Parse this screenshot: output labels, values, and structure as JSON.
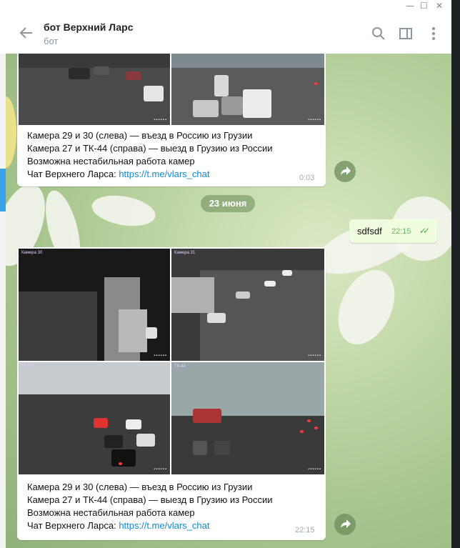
{
  "window": {
    "minimize": "—",
    "maximize": "☐",
    "close": "✕"
  },
  "header": {
    "title": "бот Верхний Ларс",
    "subtitle": "бот"
  },
  "messages": {
    "first": {
      "line1": "Камера 29 и 30 (слева) — въезд в Россию из Грузии",
      "line2": "Камера 27 и ТК-44 (справа) — выезд в Грузию из России",
      "line3": "Возможна нестабильная работа камер",
      "line4_prefix": "Чат Верхнего Ларса: ",
      "link": "https://t.me/vlars_chat",
      "time": "0:03"
    },
    "date_separator": "23 июня",
    "outgoing": {
      "text": "sdfsdf",
      "time": "22:15",
      "status": "✓✓"
    },
    "second": {
      "cam_labels": [
        "Камера 30",
        "Камера 31",
        "ТК-50",
        "ТК-44"
      ],
      "line1": "Камера 29 и 30 (слева) — въезд в Россию из Грузии",
      "line2": "Камера 27 и ТК-44 (справа) — выезд в Грузию из России",
      "line3": "Возможна нестабильная работа камер",
      "line4_prefix": "Чат Верхнего Ларса: ",
      "link": "https://t.me/vlars_chat",
      "time": "22:15"
    }
  },
  "colors": {
    "link": "#168acd",
    "outgoing_bg": "#effdde",
    "check": "#4fae4e"
  }
}
